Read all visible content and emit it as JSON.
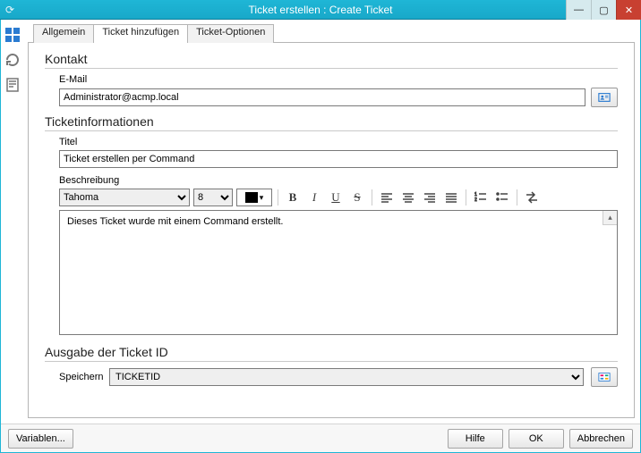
{
  "window": {
    "title": "Ticket erstellen : Create Ticket"
  },
  "tabs": {
    "general": "Allgemein",
    "add": "Ticket hinzufügen",
    "options": "Ticket-Optionen"
  },
  "kontakt": {
    "heading": "Kontakt",
    "email_label": "E-Mail",
    "email_value": "Administrator@acmp.local"
  },
  "info": {
    "heading": "Ticketinformationen",
    "title_label": "Titel",
    "title_value": "Ticket erstellen per Command",
    "desc_label": "Beschreibung",
    "font": "Tahoma",
    "size": "8",
    "body": "Dieses Ticket wurde mit einem Command erstellt."
  },
  "output": {
    "heading": "Ausgabe der Ticket ID",
    "store_label": "Speichern",
    "store_value": "TICKETID"
  },
  "footer": {
    "variables": "Variablen...",
    "help": "Hilfe",
    "ok": "OK",
    "cancel": "Abbrechen"
  }
}
